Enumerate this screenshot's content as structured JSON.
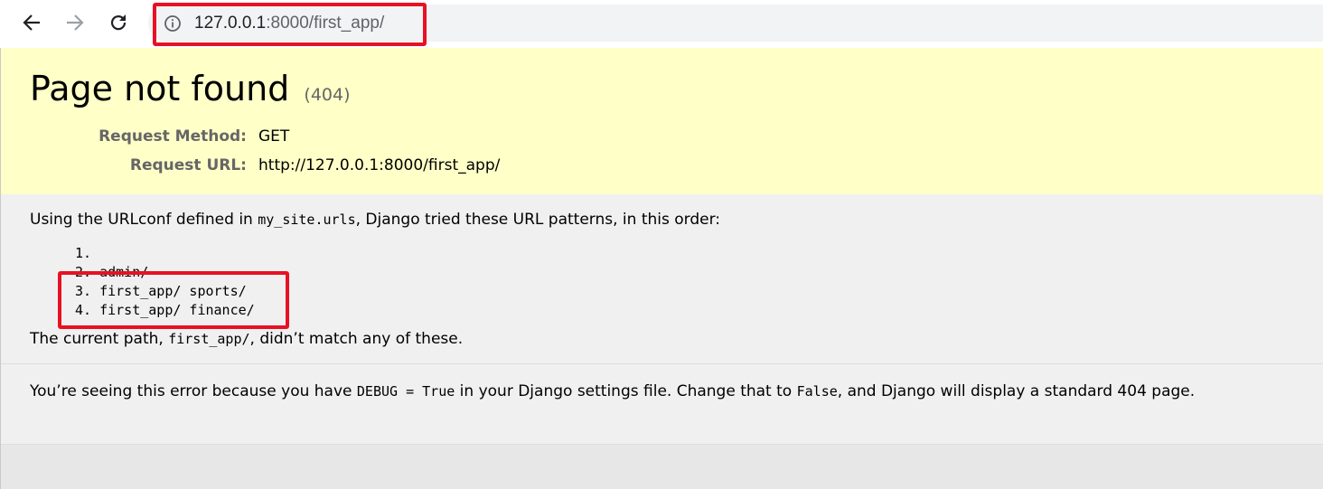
{
  "browser": {
    "back_icon": "arrow-left-icon",
    "forward_icon": "arrow-right-icon",
    "reload_icon": "reload-icon",
    "site_info_icon": "info-circle-icon",
    "url_host": "127.0.0.1",
    "url_rest": ":8000/first_app/",
    "highlight_color": "#e81123"
  },
  "summary": {
    "title": "Page not found",
    "status_code": "(404)",
    "request_method_label": "Request Method:",
    "request_method_value": "GET",
    "request_url_label": "Request URL:",
    "request_url_value": "http://127.0.0.1:8000/first_app/",
    "background_color": "#ffffc8"
  },
  "info": {
    "intro_prefix": "Using the URLconf defined in ",
    "intro_urlconf": "my_site.urls",
    "intro_suffix": ", Django tried these URL patterns, in this order:",
    "patterns": [
      "1. ",
      "2. admin/",
      "3. first_app/ sports/",
      "4. first_app/ finance/"
    ],
    "current_path_prefix": "The current path, ",
    "current_path": "first_app/",
    "current_path_suffix": ", didn’t match any of these."
  },
  "explanation": {
    "prefix": "You’re seeing this error because you have ",
    "debug_setting": "DEBUG = True",
    "middle": " in your Django settings file. Change that to ",
    "false_value": "False",
    "suffix": ", and Django will display a standard 404 page."
  }
}
